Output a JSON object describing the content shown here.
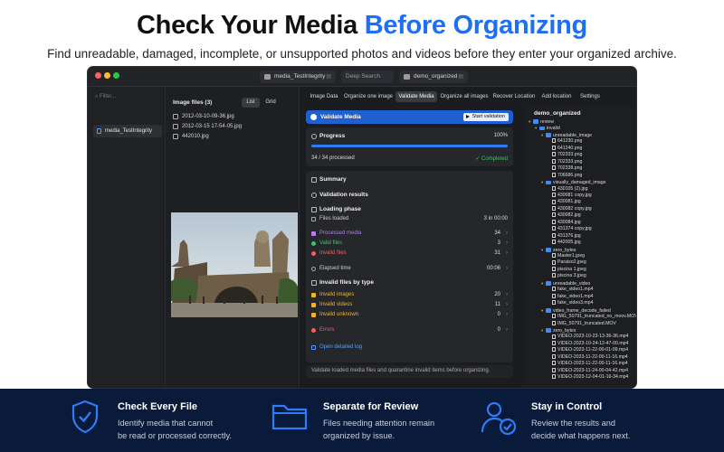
{
  "hero": {
    "title_prefix": "Check Your Media ",
    "title_accent": "Before Organizing",
    "subtitle": "Find unreadable, damaged, incomplete, or unsupported photos and videos before they enter your organized archive."
  },
  "titlebar": {
    "source_label": "media_TestIntegrity",
    "search_placeholder": "Deep Search",
    "dest_label": "demo_organized"
  },
  "sidebar": {
    "filter_placeholder": "Filter...",
    "items": [
      {
        "label": "media_TestIntegrity"
      }
    ]
  },
  "files": {
    "header": "Image files (3)",
    "view_list": "List",
    "view_grid": "Grid",
    "items": [
      "2012-03-10-09-36.jpg",
      "2012-03-15 17-54-05.jpg",
      "442010.jpg"
    ]
  },
  "tabs": [
    "Image Data",
    "Organize one image",
    "Validate Media",
    "Organize all images",
    "Recover Location",
    "Add location",
    "Settings"
  ],
  "active_tab": "Validate Media",
  "validate": {
    "header": "Validate Media",
    "start_button": "Start validation",
    "progress_label": "Progress",
    "progress_percent": "100%",
    "progress_value": 1.0,
    "processed": "34 / 34 processed",
    "completed": "Completed",
    "summary": "Summary",
    "validation_results": "Validation results",
    "loading_phase": "Loading phase",
    "files_loaded": {
      "label": "Files loaded",
      "value": "3 in 00:00"
    },
    "processed_media": {
      "label": "Processed media",
      "value": "34"
    },
    "valid_files": {
      "label": "Valid files",
      "value": "3"
    },
    "invalid_files": {
      "label": "Invalid files",
      "value": "31"
    },
    "elapsed": {
      "label": "Elapsed time",
      "value": "00:06"
    },
    "by_type": "Invalid files by type",
    "invalid_images": {
      "label": "Invalid images",
      "value": "20"
    },
    "invalid_videos": {
      "label": "Invalid videos",
      "value": "11"
    },
    "invalid_unknown": {
      "label": "Invalid unknown",
      "value": "0"
    },
    "errors": {
      "label": "Errors",
      "value": "0"
    },
    "open_log": "Open detailed log",
    "footer": "Validate loaded media files and quarantine invalid items before organizing."
  },
  "tree": {
    "title": "demo_organized",
    "items": [
      {
        "label": "review",
        "type": "folder",
        "depth": 0
      },
      {
        "label": "invalid",
        "type": "folder",
        "depth": 1
      },
      {
        "label": "unreadable_image",
        "type": "folder",
        "depth": 2
      },
      {
        "label": "641230.png",
        "type": "file",
        "depth": 3
      },
      {
        "label": "641240.png",
        "type": "file",
        "depth": 3
      },
      {
        "label": "702333.png",
        "type": "file",
        "depth": 3
      },
      {
        "label": "702333.png",
        "type": "file",
        "depth": 3
      },
      {
        "label": "702338.png",
        "type": "file",
        "depth": 3
      },
      {
        "label": "706686.png",
        "type": "file",
        "depth": 3
      },
      {
        "label": "visually_damaged_image",
        "type": "folder",
        "depth": 2
      },
      {
        "label": "430105 (2).jpg",
        "type": "file",
        "depth": 3
      },
      {
        "label": "430081 copy.jpg",
        "type": "file",
        "depth": 3
      },
      {
        "label": "430081.jpg",
        "type": "file",
        "depth": 3
      },
      {
        "label": "430082 copy.jpg",
        "type": "file",
        "depth": 3
      },
      {
        "label": "430082.jpg",
        "type": "file",
        "depth": 3
      },
      {
        "label": "430084.jpg",
        "type": "file",
        "depth": 3
      },
      {
        "label": "431374 copy.jpg",
        "type": "file",
        "depth": 3
      },
      {
        "label": "431376.jpg",
        "type": "file",
        "depth": 3
      },
      {
        "label": "442005.jpg",
        "type": "file",
        "depth": 3
      },
      {
        "label": "zero_bytes",
        "type": "folder",
        "depth": 2
      },
      {
        "label": "Master1.jpeg",
        "type": "file",
        "depth": 3
      },
      {
        "label": "Paraiso2.jpeg",
        "type": "file",
        "depth": 3
      },
      {
        "label": "piscina 1.jpeg",
        "type": "file",
        "depth": 3
      },
      {
        "label": "piscina 3.jpeg",
        "type": "file",
        "depth": 3
      },
      {
        "label": "unreadable_video",
        "type": "folder",
        "depth": 2
      },
      {
        "label": "fake_video1.mp4",
        "type": "file",
        "depth": 3
      },
      {
        "label": "fake_video1.mp4",
        "type": "file",
        "depth": 3
      },
      {
        "label": "fake_video3.mp4",
        "type": "file",
        "depth": 3
      },
      {
        "label": "video_frame_decode_failed",
        "type": "folder",
        "depth": 2
      },
      {
        "label": "IMG_50791_truncated_no_moov.MOV",
        "type": "file",
        "depth": 3
      },
      {
        "label": "IMG_50791_truncated.MOV",
        "type": "file",
        "depth": 3
      },
      {
        "label": "zero_bytes",
        "type": "folder",
        "depth": 2
      },
      {
        "label": "VIDEO-2023-10-23-13-36-36.mp4",
        "type": "file",
        "depth": 3
      },
      {
        "label": "VIDEO-2023-10-24-12-47-00.mp4",
        "type": "file",
        "depth": 3
      },
      {
        "label": "VIDEO-2023-11-22-00-01-09.mp4",
        "type": "file",
        "depth": 3
      },
      {
        "label": "VIDEO-2023-11-22-00-11-16.mp4",
        "type": "file",
        "depth": 3
      },
      {
        "label": "VIDEO-2023-11-22-00-11-16.mp4",
        "type": "file",
        "depth": 3
      },
      {
        "label": "VIDEO-2023-11-24-00-04-42.mp4",
        "type": "file",
        "depth": 3
      },
      {
        "label": "VIDEO-2023-12-04-01-16-34.mp4",
        "type": "file",
        "depth": 3
      }
    ]
  },
  "features": [
    {
      "title": "Check Every File",
      "line1": "Identify media that cannot",
      "line2": "be read or processed correctly.",
      "icon": "shield-check-icon"
    },
    {
      "title": "Separate for Review",
      "line1": "Files needing attention remain",
      "line2": "organized by issue.",
      "icon": "folder-icon"
    },
    {
      "title": "Stay in Control",
      "line1": "Review the results and",
      "line2": "decide what happens next.",
      "icon": "user-check-icon"
    }
  ],
  "colors": {
    "accent": "#1f6ff2",
    "bottom_bg": "#0a1a3a",
    "purple": "#b57cf0",
    "green": "#39c46b",
    "red": "#ff5a5a",
    "amber": "#f0b429",
    "folder": "#3b8ef5"
  }
}
